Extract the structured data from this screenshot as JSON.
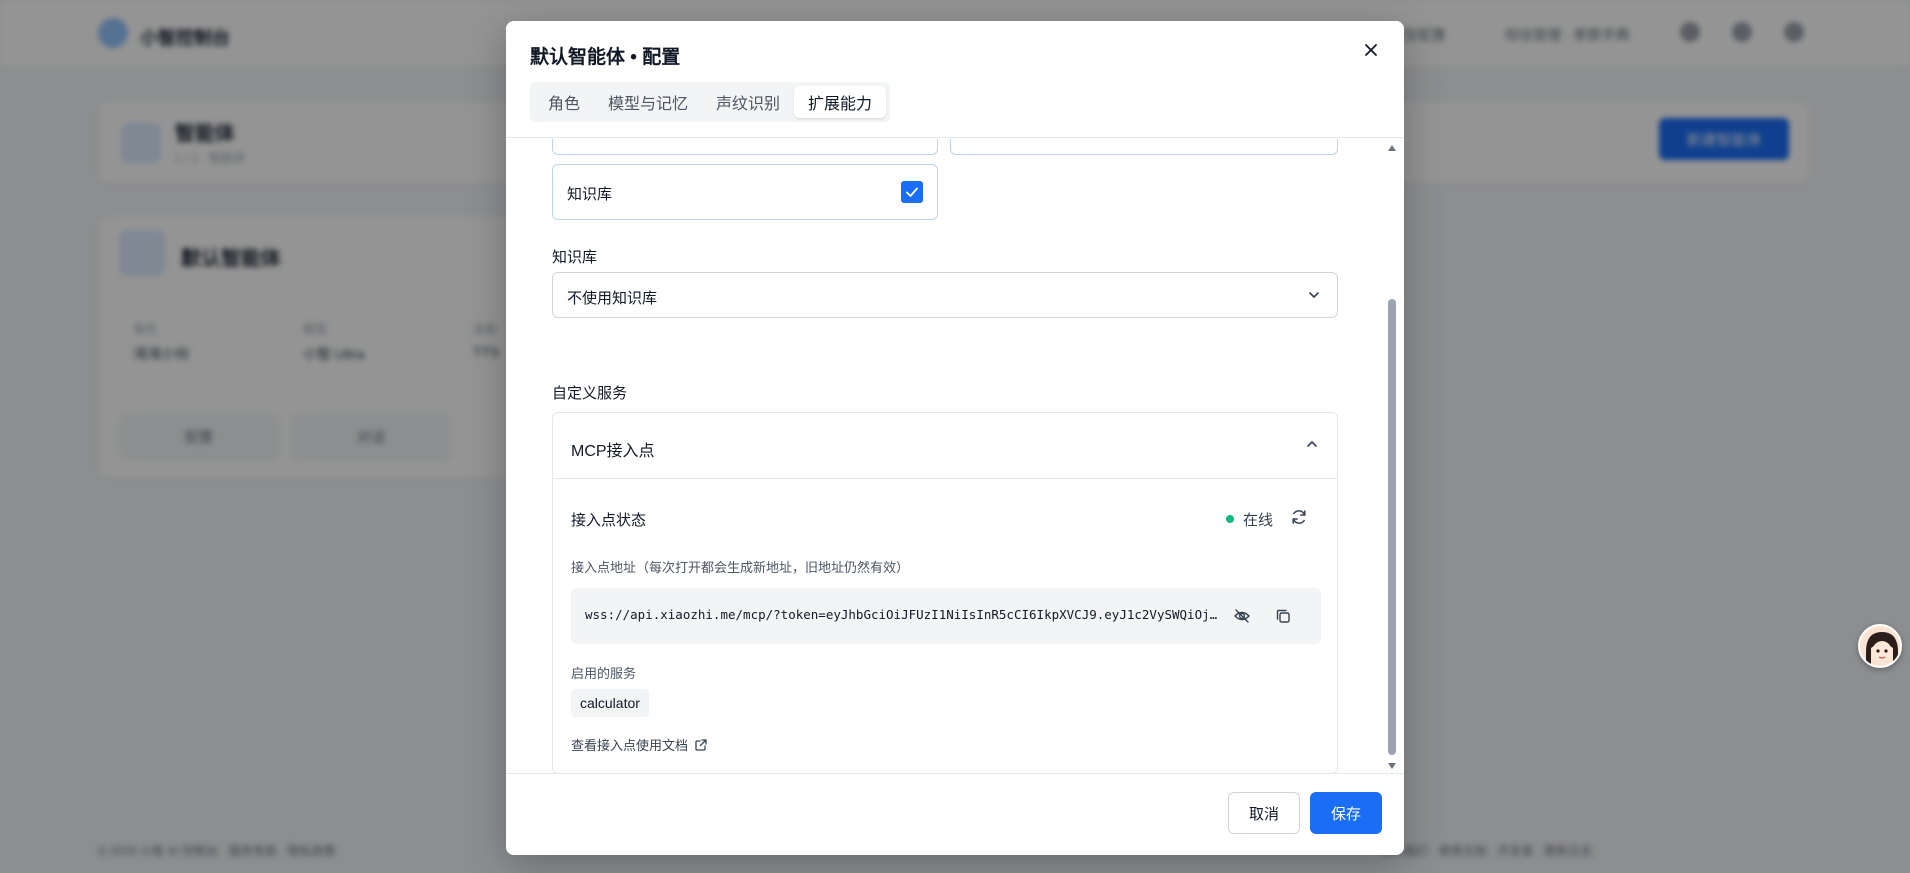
{
  "background": {
    "logo_text": "小智控制台",
    "nav": [
      "模型配置",
      "短信管理 · 参数字典"
    ],
    "page_card": {
      "title": "智能体",
      "subtitle": "1 / 1 · 智能体"
    },
    "create_button": "新建智能体",
    "agent_card": {
      "name": "默认智能体",
      "stats": [
        {
          "label": "角色",
          "value": "湾湾小何"
        },
        {
          "label": "模型",
          "value": "小智 Ultra"
        },
        {
          "label": "设备",
          "value": "TTS"
        }
      ],
      "actions": [
        "配置",
        "对话"
      ]
    },
    "footer_left": "© 2025 小智 AI 控制台 · 服务条款 · 隐私政策",
    "footer_right": "联系我们 · 使用文档 · 开发者 · 更新日志"
  },
  "modal": {
    "title": "默认智能体 • 配置",
    "tabs": [
      "角色",
      "模型与记忆",
      "声纹识别",
      "扩展能力"
    ],
    "active_tab": "扩展能力",
    "knowledge_checkbox_label": "知识库",
    "knowledge_section_label": "知识库",
    "knowledge_select_value": "不使用知识库",
    "custom_service_label": "自定义服务",
    "mcp": {
      "title": "MCP接入点",
      "status_label": "接入点状态",
      "status_text": "在线",
      "address_label": "接入点地址（每次打开都会生成新地址，旧地址仍然有效）",
      "address_value": "wss://api.xiaozhi.me/mcp/?token=eyJhbGciOiJFUzI1NiIsInR5cCI6IkpXVCJ9.eyJ1c2VySWQiOjEyMzQ1LCJhZ2VudElkIjo2Nzg5fQ",
      "enabled_services_label": "启用的服务",
      "services": [
        "calculator"
      ],
      "doc_link": "查看接入点使用文档"
    },
    "cancel_label": "取消",
    "save_label": "保存"
  },
  "colors": {
    "primary": "#1a6df5",
    "online": "#10b981",
    "overlay": "rgba(0,0,0,0.42)"
  }
}
